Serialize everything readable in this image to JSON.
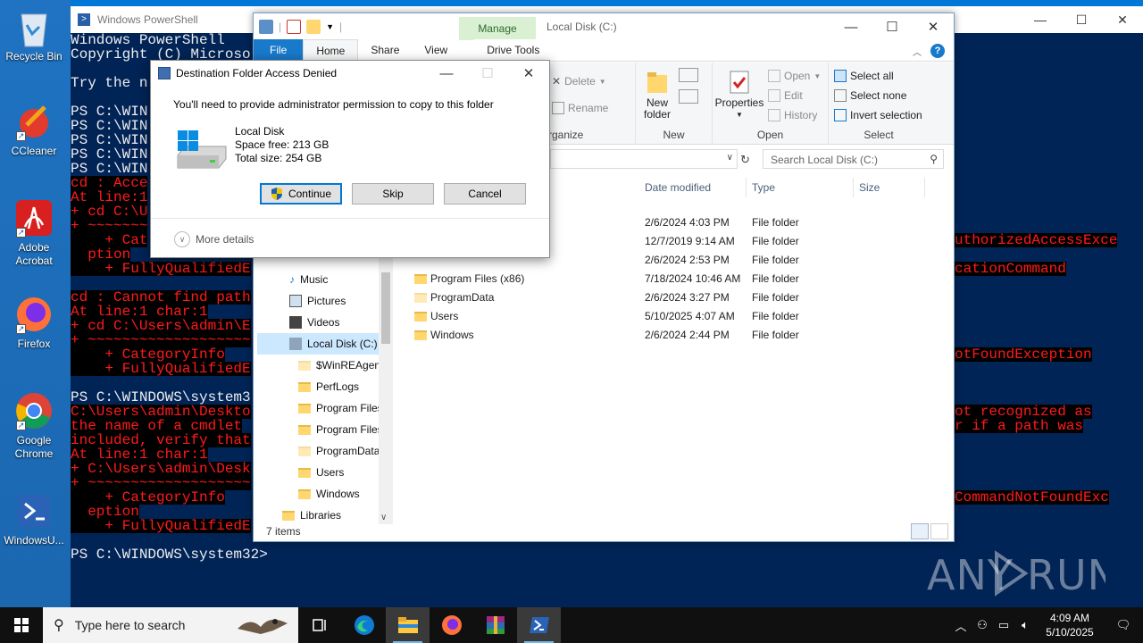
{
  "desktop": {
    "icons": [
      {
        "name": "recycle-bin",
        "label": "Recycle Bin"
      },
      {
        "name": "ccleaner",
        "label": "CCleaner"
      },
      {
        "name": "adobe-acrobat",
        "label": "Adobe Acrobat"
      },
      {
        "name": "firefox",
        "label": "Firefox"
      },
      {
        "name": "google-chrome",
        "label": "Google Chrome"
      },
      {
        "name": "windowsupdate",
        "label": "WindowsU..."
      }
    ]
  },
  "powershell": {
    "title": "Windows PowerShell",
    "lines": [
      "Windows PowerShell",
      "Copyright (C) Microso",
      "",
      "Try the n",
      "",
      "PS C:\\WIN",
      "PS C:\\WIN",
      "PS C:\\WIN",
      "PS C:\\WIN",
      "PS C:\\WIN",
      "cd : Acce",
      "At line:1",
      "+ cd C:\\U",
      "+ ~~~~~~~",
      "    + Cat",
      "  ption",
      "    + FullyQualifiedE",
      "",
      "cd : Cannot find path",
      "At line:1 char:1",
      "+ cd C:\\Users\\admin\\E",
      "+ ~~~~~~~~~~~~~~~~~~~",
      "    + CategoryInfo",
      "    + FullyQualifiedE",
      "",
      "PS C:\\WINDOWS\\system3",
      "C:\\Users\\admin\\Deskto",
      "the name of a cmdlet",
      "included, verify that",
      "At line:1 char:1",
      "+ C:\\Users\\admin\\Desk",
      "+ ~~~~~~~~~~~~~~~~~~~",
      "    + CategoryInfo",
      "  eption",
      "    + FullyQualifiedE",
      "",
      "PS C:\\WINDOWS\\system32>"
    ],
    "right_fragments": [
      "uthorizedAccessExce",
      "cationCommand",
      "otFoundException",
      "ot recognized as",
      "r if a path was",
      "CommandNotFoundExc"
    ]
  },
  "explorer": {
    "title": "Local Disk (C:)",
    "manage_tab": "Manage",
    "tabs": [
      "File",
      "Home",
      "Share",
      "View",
      "Drive Tools"
    ],
    "ribbon": {
      "organize_label": "rganize",
      "delete": "Delete",
      "rename": "Rename",
      "new_folder": "New\nfolder",
      "new_label": "New",
      "properties": "Properties",
      "open": "Open",
      "edit": "Edit",
      "history": "History",
      "open_label": "Open",
      "select_all": "Select all",
      "select_none": "Select none",
      "invert_selection": "Invert selection",
      "select_label": "Select"
    },
    "search_placeholder": "Search Local Disk (C:)",
    "nav": [
      "Music",
      "Pictures",
      "Videos",
      "Local Disk (C:)",
      "$WinREAgent",
      "PerfLogs",
      "Program Files",
      "Program Files",
      "ProgramData",
      "Users",
      "Windows",
      "Libraries"
    ],
    "columns": [
      "Date modified",
      "Type",
      "Size"
    ],
    "files": [
      {
        "name": "",
        "date": "2/6/2024 4:03 PM",
        "type": "File folder"
      },
      {
        "name": "",
        "date": "12/7/2019 9:14 AM",
        "type": "File folder"
      },
      {
        "name": "",
        "date": "2/6/2024 2:53 PM",
        "type": "File folder"
      },
      {
        "name": "Program Files (x86)",
        "date": "7/18/2024 10:46 AM",
        "type": "File folder"
      },
      {
        "name": "ProgramData",
        "date": "2/6/2024 3:27 PM",
        "type": "File folder"
      },
      {
        "name": "Users",
        "date": "5/10/2025 4:07 AM",
        "type": "File folder"
      },
      {
        "name": "Windows",
        "date": "2/6/2024 2:44 PM",
        "type": "File folder"
      }
    ],
    "status": "7 items"
  },
  "dialog": {
    "title": "Destination Folder Access Denied",
    "message": "You'll need to provide administrator permission to copy to this folder",
    "drive_name": "Local Disk",
    "space_free": "Space free: 213 GB",
    "total_size": "Total size: 254 GB",
    "continue": "Continue",
    "skip": "Skip",
    "cancel": "Cancel",
    "more_details": "More details"
  },
  "taskbar": {
    "search_placeholder": "Type here to search",
    "time": "4:09 AM",
    "date": "5/10/2025"
  },
  "watermark": "ANY RUN",
  "colors": {
    "console_bg": "#012456",
    "error_red": "#ff1a1a",
    "accent": "#0078d7"
  }
}
